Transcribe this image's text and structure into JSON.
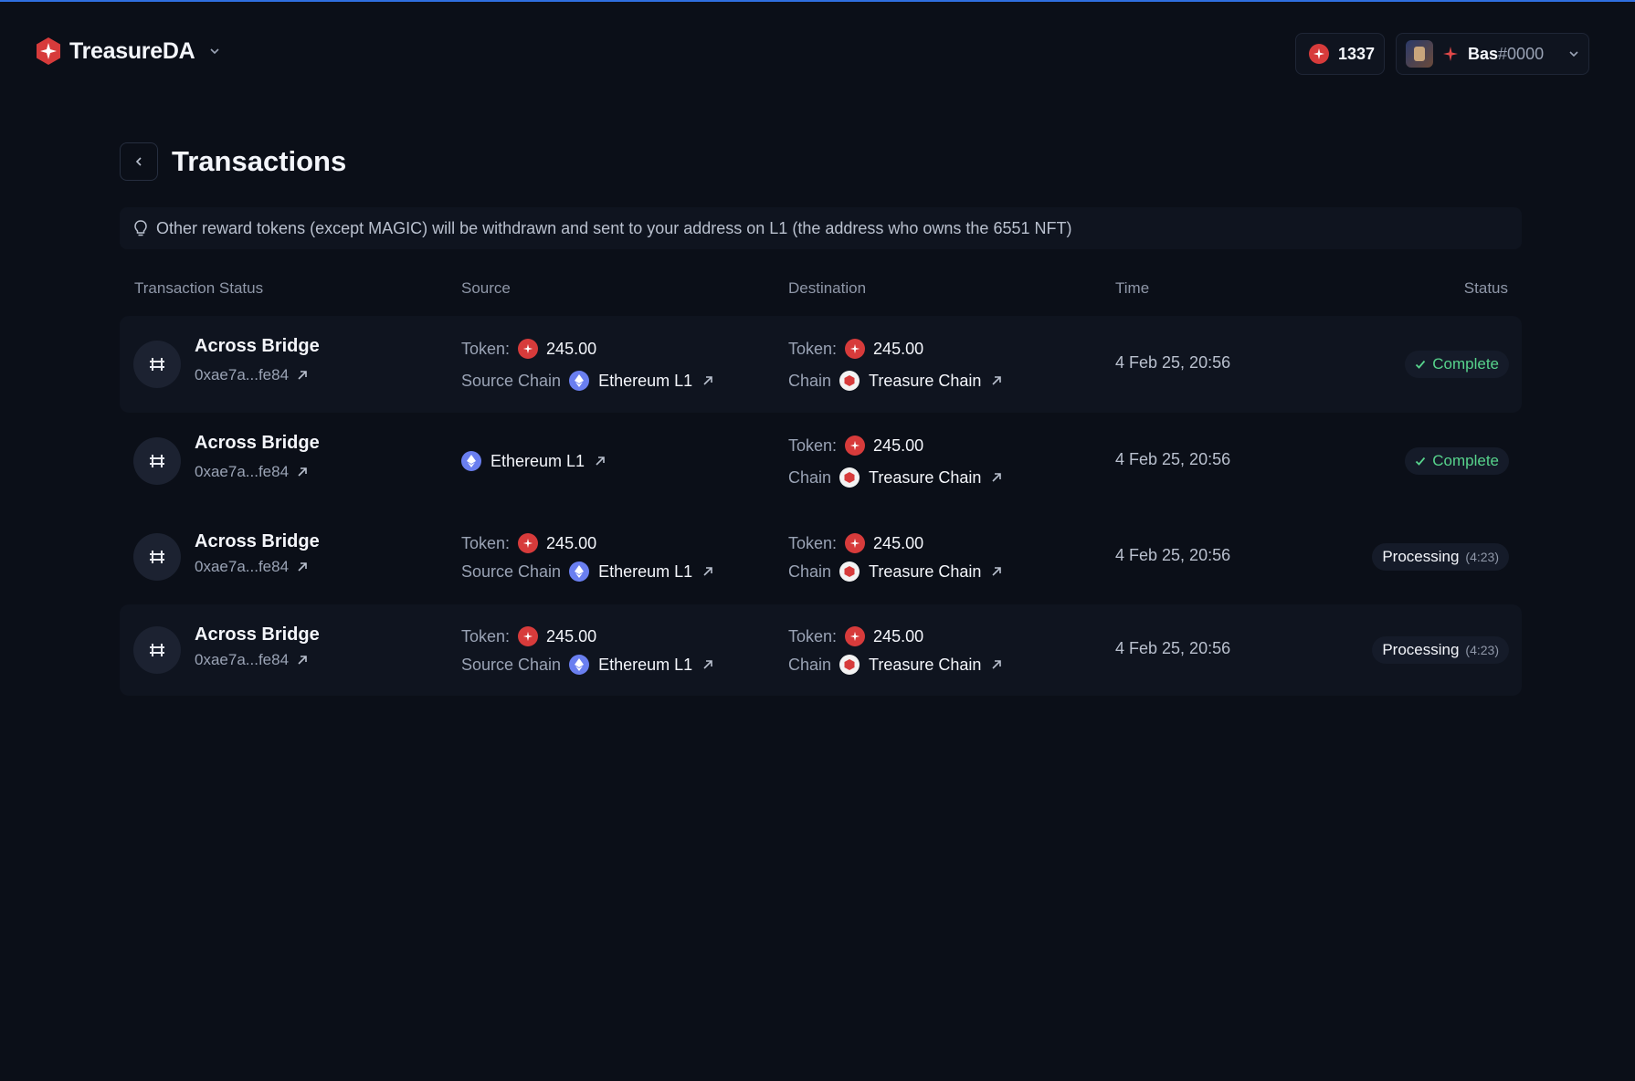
{
  "app": {
    "brand": "TreasureDA",
    "balance": "1337",
    "user_name": "Bas",
    "user_tag": "#0000"
  },
  "page": {
    "title": "Transactions",
    "notice": "Other reward tokens (except MAGIC) will be withdrawn and sent to your address on L1 (the address who owns the 6551 NFT)"
  },
  "table": {
    "headers": {
      "status": "Transaction Status",
      "source": "Source",
      "destination": "Destination",
      "time": "Time",
      "badge": "Status"
    },
    "rows": [
      {
        "title": "Across Bridge",
        "hash": "0xae7a...fe84",
        "source_token_label": "Token:",
        "source_token_amount": "245.00",
        "source_chain_label": "Source Chain",
        "source_chain": "Ethereum L1",
        "dest_token_label": "Token:",
        "dest_token_amount": "245.00",
        "dest_chain_label": "Chain",
        "dest_chain": "Treasure Chain",
        "time": "4 Feb 25, 20:56",
        "status": "Complete",
        "status_type": "complete"
      },
      {
        "title": "Across Bridge",
        "hash": "0xae7a...fe84",
        "source_chain": "Ethereum L1",
        "dest_token_label": "Token:",
        "dest_token_amount": "245.00",
        "dest_chain_label": "Chain",
        "dest_chain": "Treasure Chain",
        "time": "4 Feb 25, 20:56",
        "status": "Complete",
        "status_type": "complete"
      },
      {
        "title": "Across Bridge",
        "hash": "0xae7a...fe84",
        "source_token_label": "Token:",
        "source_token_amount": "245.00",
        "source_chain_label": "Source Chain",
        "source_chain": "Ethereum L1",
        "dest_token_label": "Token:",
        "dest_token_amount": "245.00",
        "dest_chain_label": "Chain",
        "dest_chain": "Treasure Chain",
        "time": "4 Feb 25, 20:56",
        "status": "Processing",
        "status_eta": "(4:23)",
        "status_type": "processing"
      },
      {
        "title": "Across Bridge",
        "hash": "0xae7a...fe84",
        "source_token_label": "Token:",
        "source_token_amount": "245.00",
        "source_chain_label": "Source Chain",
        "source_chain": "Ethereum L1",
        "dest_token_label": "Token:",
        "dest_token_amount": "245.00",
        "dest_chain_label": "Chain",
        "dest_chain": "Treasure Chain",
        "time": "4 Feb 25, 20:56",
        "status": "Processing",
        "status_eta": "(4:23)",
        "status_type": "processing"
      }
    ]
  },
  "colors": {
    "background": "#0b0f18",
    "accent_line": "#2f6fe0",
    "complete": "#57d38c",
    "magic": "#d73b3b",
    "eth": "#6a7ff0"
  },
  "icons": [
    "treasure-logo-icon",
    "chevron-down-icon",
    "magic-coin-icon",
    "chevron-left-icon",
    "lightbulb-icon",
    "bridge-icon",
    "external-link-icon",
    "ethereum-icon",
    "treasure-chain-icon",
    "check-icon"
  ]
}
